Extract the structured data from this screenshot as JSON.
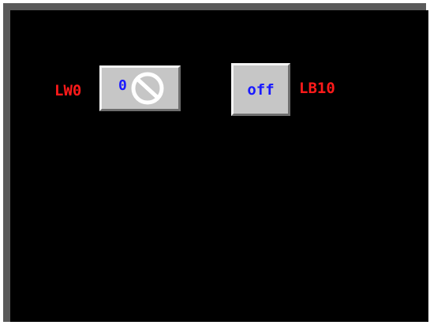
{
  "hmi": {
    "word_lamp": {
      "address_label": "LW0",
      "value": "0",
      "icon": "prohibited-icon"
    },
    "bit_switch": {
      "address_label": "LB10",
      "state_label": "off"
    }
  },
  "colors": {
    "background": "#000000",
    "bezel": "#5a5a5a",
    "address_text": "#ff1a1a",
    "value_text": "#1a1aff",
    "button_face": "#c6c6c6"
  }
}
